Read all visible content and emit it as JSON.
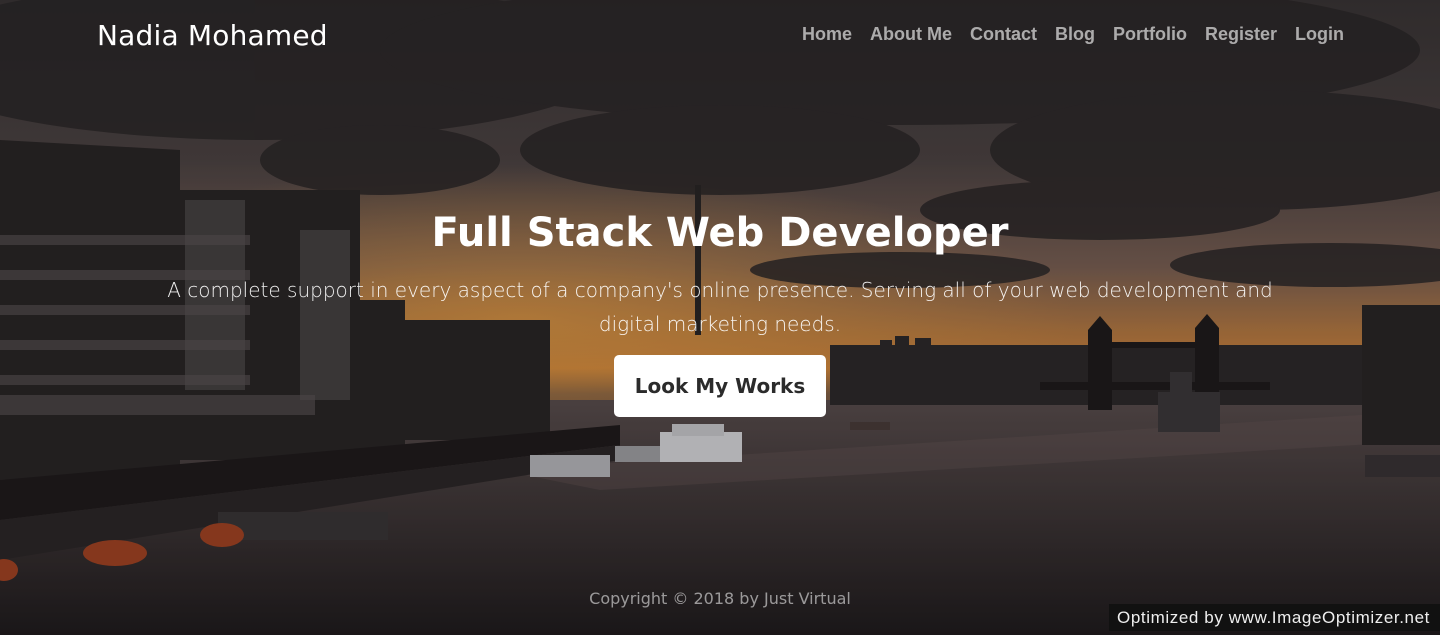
{
  "brand": {
    "name": "Nadia Mohamed"
  },
  "nav": {
    "items": [
      "Home",
      "About Me",
      "Contact",
      "Blog",
      "Portfolio",
      "Register",
      "Login"
    ]
  },
  "hero": {
    "title": "Full Stack Web Developer",
    "subtitle": "A complete support in every aspect of a company's online presence. Serving all of your web development and digital marketing needs.",
    "cta_label": "Look My Works"
  },
  "footer": {
    "copyright": "Copyright © 2018 by Just Virtual"
  },
  "watermark": {
    "text": "Optimized by www.ImageOptimizer.net"
  },
  "colors": {
    "cta_bg": "#ffffff",
    "cta_text": "#2b2b2b",
    "sky_glow": "#d98a3a"
  }
}
